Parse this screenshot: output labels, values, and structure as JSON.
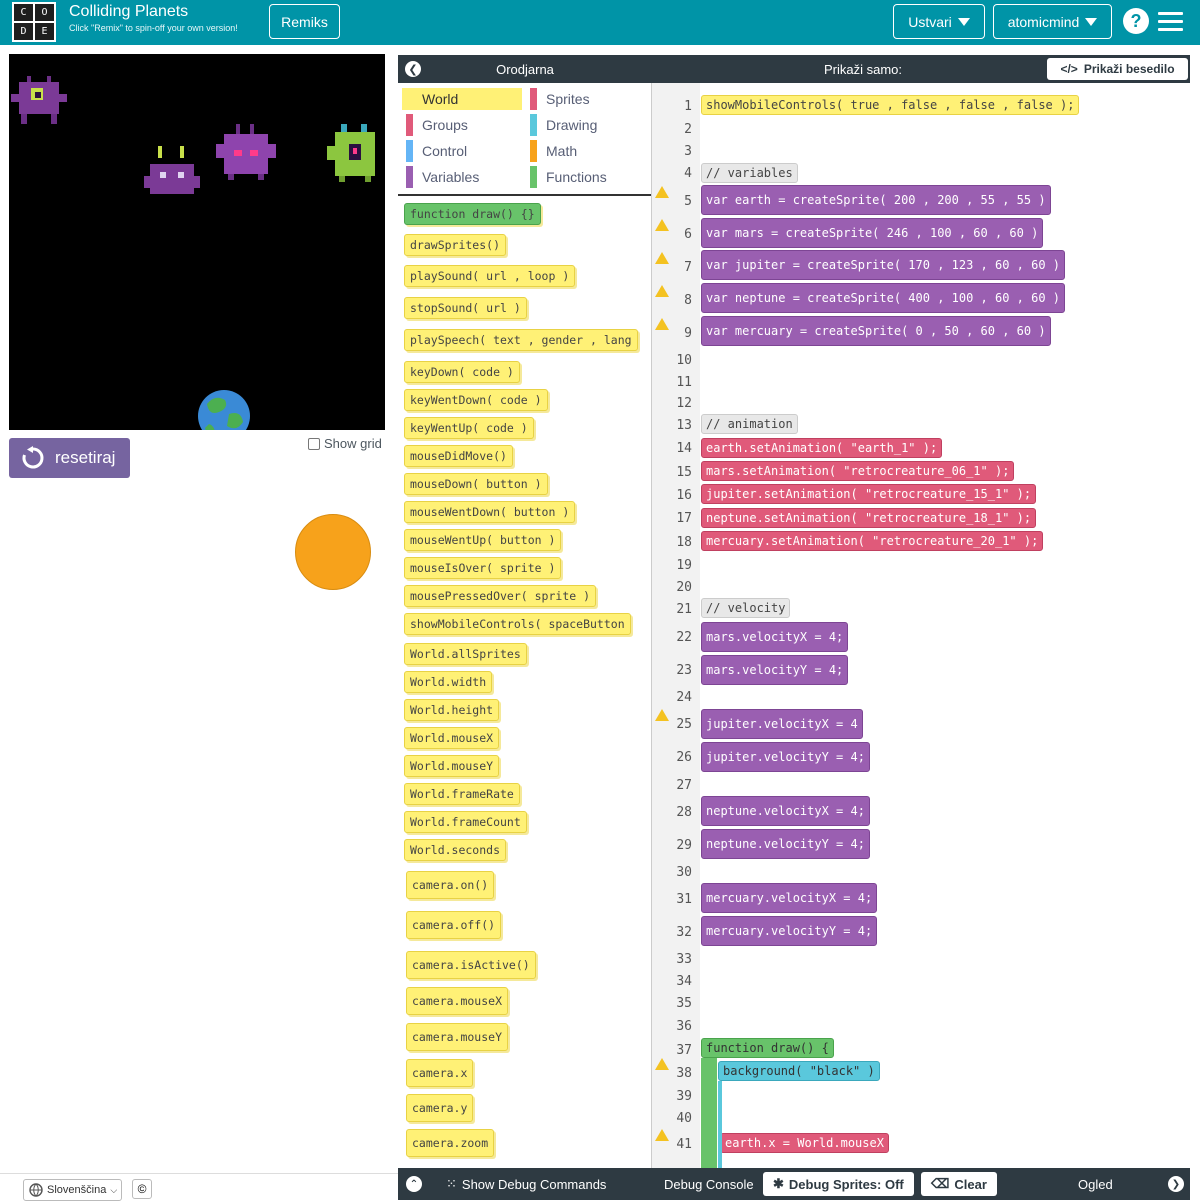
{
  "header": {
    "logo_letters": [
      "C",
      "O",
      "D",
      "E"
    ],
    "title": "Colliding Planets",
    "subtitle": "Click \"Remix\" to spin-off your own version!",
    "remix_label": "Remiks",
    "create_label": "Ustvari",
    "user_label": "atomicmind",
    "help_icon": "?",
    "colors": {
      "bar": "#0094a7",
      "reset": "#7664a0"
    }
  },
  "stage": {
    "reset_label": "resetiraj",
    "show_grid_label": "Show grid"
  },
  "footer": {
    "language_label": "Slovenščina",
    "copyright_icon": "©"
  },
  "toolbox": {
    "title": "Orodjarna",
    "categories": [
      {
        "label": "World",
        "color": "#fff176",
        "selected": true
      },
      {
        "label": "Sprites",
        "color": "#e05a7a"
      },
      {
        "label": "Groups",
        "color": "#e05a7a"
      },
      {
        "label": "Drawing",
        "color": "#5ac8dc"
      },
      {
        "label": "Control",
        "color": "#64b5f6"
      },
      {
        "label": "Math",
        "color": "#f7a21b"
      },
      {
        "label": "Variables",
        "color": "#9a5fb1"
      },
      {
        "label": "Functions",
        "color": "#68c36a"
      }
    ],
    "blocks": [
      {
        "text": "function draw() {}"
      },
      {
        "text": "drawSprites()"
      },
      {
        "text": "playSound( url , loop )"
      },
      {
        "text": "stopSound( url )"
      },
      {
        "text": "playSpeech( text , gender , lang"
      },
      {
        "text": "keyDown( code )"
      },
      {
        "text": "keyWentDown( code )"
      },
      {
        "text": "keyWentUp( code )"
      },
      {
        "text": "mouseDidMove()"
      },
      {
        "text": "mouseDown( button )"
      },
      {
        "text": "mouseWentDown( button )"
      },
      {
        "text": "mouseWentUp( button )"
      },
      {
        "text": "mouseIsOver( sprite )"
      },
      {
        "text": "mousePressedOver( sprite )"
      },
      {
        "text": "showMobileControls( spaceButton"
      },
      {
        "text": "World.allSprites"
      },
      {
        "text": "World.width"
      },
      {
        "text": "World.height"
      },
      {
        "text": "World.mouseX"
      },
      {
        "text": "World.mouseY"
      },
      {
        "text": "World.frameRate"
      },
      {
        "text": "World.frameCount"
      },
      {
        "text": "World.seconds"
      },
      {
        "text": "camera.on()"
      },
      {
        "text": "camera.off()"
      },
      {
        "text": "camera.isActive()"
      },
      {
        "text": "camera.mouseX"
      },
      {
        "text": "camera.mouseY"
      },
      {
        "text": "camera.x"
      },
      {
        "text": "camera.y"
      },
      {
        "text": "camera.zoom"
      }
    ]
  },
  "editor": {
    "header_label": "Prikaži samo:",
    "show_text_label": "Prikaži besedilo",
    "line_numbers": [
      "1",
      "2",
      "3",
      "4",
      "5",
      "6",
      "7",
      "8",
      "9",
      "10",
      "11",
      "12",
      "13",
      "14",
      "15",
      "16",
      "17",
      "18",
      "19",
      "20",
      "21",
      "22",
      "23",
      "24",
      "25",
      "26",
      "27",
      "28",
      "29",
      "30",
      "31",
      "32",
      "33",
      "34",
      "35",
      "36",
      "37",
      "38",
      "39",
      "40",
      "41"
    ],
    "lines": [
      {
        "n": 1,
        "style": "yel",
        "text": "showMobileControls( true , false , false , false );"
      },
      {
        "n": 4,
        "style": "gray",
        "text": "// variables"
      },
      {
        "n": 5,
        "style": "purple",
        "text": "var earth = createSprite( 200 , 200 , 55 , 55 )"
      },
      {
        "n": 6,
        "style": "purple",
        "text": "var mars = createSprite( 246 , 100 , 60 , 60 )"
      },
      {
        "n": 7,
        "style": "purple",
        "text": "var jupiter = createSprite( 170 , 123 , 60 , 60 )"
      },
      {
        "n": 8,
        "style": "purple",
        "text": "var neptune = createSprite( 400 , 100 , 60 , 60 )"
      },
      {
        "n": 9,
        "style": "purple",
        "text": "var mercuary = createSprite( 0 , 50 , 60 , 60 )"
      },
      {
        "n": 13,
        "style": "gray",
        "text": "// animation"
      },
      {
        "n": 14,
        "style": "pink",
        "text": "earth.setAnimation( \"earth_1\" );"
      },
      {
        "n": 15,
        "style": "pink",
        "text": "mars.setAnimation( \"retrocreature_06_1\" );"
      },
      {
        "n": 16,
        "style": "pink",
        "text": "jupiter.setAnimation( \"retrocreature_15_1\" );"
      },
      {
        "n": 17,
        "style": "pink",
        "text": "neptune.setAnimation( \"retrocreature_18_1\" );"
      },
      {
        "n": 18,
        "style": "pink",
        "text": "mercuary.setAnimation( \"retrocreature_20_1\" );"
      },
      {
        "n": 21,
        "style": "gray",
        "text": "// velocity"
      },
      {
        "n": 22,
        "style": "purple",
        "text": "mars.velocityX = 4;"
      },
      {
        "n": 23,
        "style": "purple",
        "text": "mars.velocityY = 4;"
      },
      {
        "n": 25,
        "style": "purple",
        "text": "jupiter.velocityX = 4"
      },
      {
        "n": 26,
        "style": "purple",
        "text": "jupiter.velocityY = 4;"
      },
      {
        "n": 28,
        "style": "purple",
        "text": "neptune.velocityX = 4;"
      },
      {
        "n": 29,
        "style": "purple",
        "text": "neptune.velocityY = 4;"
      },
      {
        "n": 31,
        "style": "purple",
        "text": "mercuary.velocityX = 4;"
      },
      {
        "n": 32,
        "style": "purple",
        "text": "mercuary.velocityY = 4;"
      },
      {
        "n": 37,
        "style": "green",
        "text": "function draw() {"
      },
      {
        "n": 38,
        "style": "cyan",
        "text": "background( \"black\" )"
      },
      {
        "n": 41,
        "style": "pink",
        "text": "earth.x = World.mouseX"
      }
    ],
    "warning_lines": [
      5,
      6,
      7,
      8,
      9,
      25,
      38,
      41
    ]
  },
  "bottom": {
    "debug_commands_label": "Show Debug Commands",
    "debug_console_label": "Debug Console",
    "debug_sprites_label": "Debug Sprites: Off",
    "clear_label": "Clear",
    "watch_label": "Ogled"
  }
}
